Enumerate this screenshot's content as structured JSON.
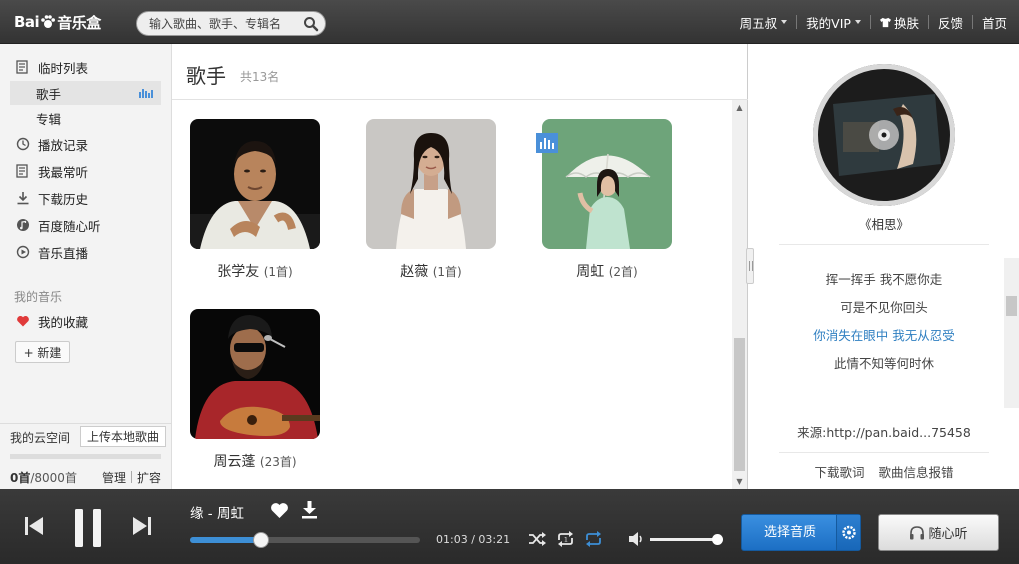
{
  "header": {
    "logo_text": "Bai",
    "logo_suffix": "音乐盒",
    "search_placeholder": "输入歌曲、歌手、专辑名",
    "nav": [
      {
        "label": "周五叔",
        "has_caret": true
      },
      {
        "label": "我的VIP",
        "has_caret": true
      },
      {
        "label": "换肤"
      },
      {
        "label": "反馈"
      },
      {
        "label": "首页"
      }
    ]
  },
  "sidebar": {
    "items": [
      {
        "label": "临时列表",
        "icon": "list-icon"
      },
      {
        "label": "歌手",
        "icon": "",
        "sub": true,
        "active": true
      },
      {
        "label": "专辑",
        "icon": "",
        "sub": true
      },
      {
        "label": "播放记录",
        "icon": "history-icon"
      },
      {
        "label": "我最常听",
        "icon": "list-icon"
      },
      {
        "label": "下载历史",
        "icon": "download-icon"
      },
      {
        "label": "百度随心听",
        "icon": "music-note-icon"
      },
      {
        "label": "音乐直播",
        "icon": "play-circle-icon"
      }
    ],
    "my_music_section": "我的音乐",
    "favorites": "我的收藏",
    "new_button": "+ 新建",
    "cloud_title": "我的云空间",
    "upload_button": "上传本地歌曲",
    "usage_used": "0首",
    "usage_total": "/8000首",
    "manage": "管理",
    "expand": "扩容"
  },
  "main": {
    "title": "歌手",
    "count": "共13名",
    "artists": [
      {
        "name": "张学友",
        "count": "(1首)"
      },
      {
        "name": "赵薇",
        "count": "(1首)"
      },
      {
        "name": "周虹",
        "count": "(2首)",
        "playing": true
      },
      {
        "name": "周云蓬",
        "count": "(23首)"
      }
    ]
  },
  "right_pane": {
    "song_name": "《相思》",
    "lyrics": [
      {
        "text": "挥一挥手 我不愿你走",
        "current": false
      },
      {
        "text": "可是不见你回头",
        "current": false
      },
      {
        "text": "你消失在眼中 我无从忍受",
        "current": true
      },
      {
        "text": "此情不知等何时休",
        "current": false
      }
    ],
    "source": "来源:http://pan.baid...75458",
    "download_lyrics": "下载歌词",
    "report": "歌曲信息报错"
  },
  "player": {
    "now_playing": "缘  -  周虹",
    "current_time": "01:03",
    "total_time": "03:21",
    "time_display": "01:03 / 03:21",
    "progress_fraction": 0.31,
    "volume_fraction": 1.0,
    "quality_button": "选择音质",
    "random_listen": "随心听"
  },
  "colors": {
    "accent_blue": "#2f7fc1",
    "topbar": "#3c3c3c",
    "player_bg": "#2e2e2e"
  }
}
